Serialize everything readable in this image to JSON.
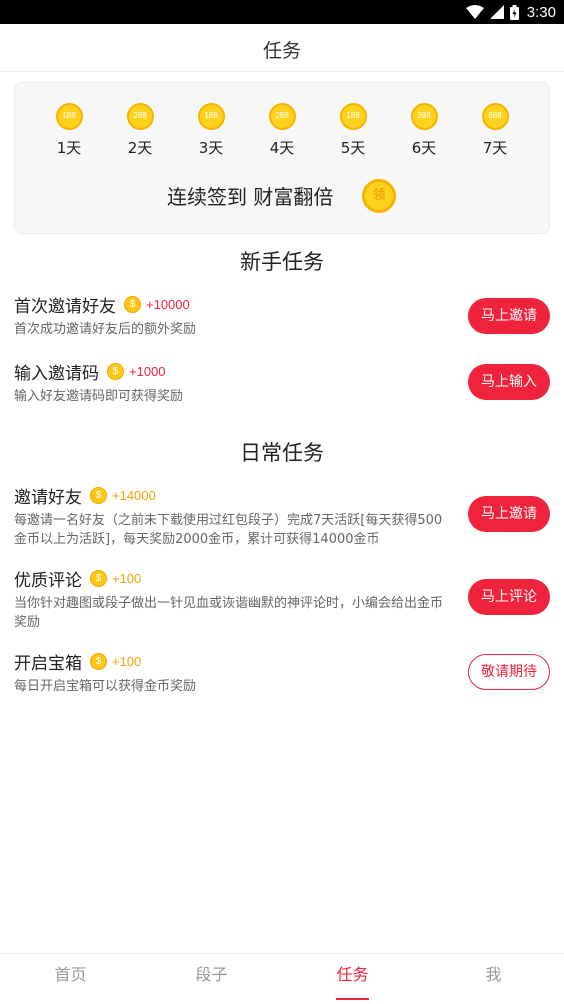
{
  "status_bar": {
    "time": "3:30"
  },
  "header": {
    "title": "任务"
  },
  "checkin": {
    "days": [
      {
        "coin": "188",
        "label": "1天"
      },
      {
        "coin": "288",
        "label": "2天"
      },
      {
        "coin": "188",
        "label": "3天"
      },
      {
        "coin": "288",
        "label": "4天"
      },
      {
        "coin": "188",
        "label": "5天"
      },
      {
        "coin": "288",
        "label": "6天"
      },
      {
        "coin": "688",
        "label": "7天"
      }
    ],
    "slogan": "连续签到 财富翻倍",
    "claim_label": "领"
  },
  "coin_glyph": "$",
  "newbie": {
    "title": "新手任务",
    "tasks": [
      {
        "name": "首次邀请好友",
        "reward": "+10000",
        "desc": "首次成功邀请好友后的额外奖励",
        "button": "马上邀请"
      },
      {
        "name": "输入邀请码",
        "reward": "+1000",
        "desc": "输入好友邀请码即可获得奖励",
        "button": "马上输入"
      }
    ]
  },
  "daily": {
    "title": "日常任务",
    "tasks": [
      {
        "name": "邀请好友",
        "reward": "+14000",
        "desc": "每邀请一名好友（之前未下载使用过红包段子）完成7天活跃[每天获得500金币以上为活跃]，每天奖励2000金币，累计可获得14000金币",
        "button": "马上邀请"
      },
      {
        "name": "优质评论",
        "reward": "+100",
        "desc": "当你针对趣图或段子做出一针见血或诙谐幽默的神评论时，小编会给出金币奖励",
        "button": "马上评论"
      },
      {
        "name": "开启宝箱",
        "reward": "+100",
        "desc": "每日开启宝箱可以获得金币奖励",
        "button": "敬请期待"
      }
    ]
  },
  "tabs": [
    {
      "label": "首页"
    },
    {
      "label": "段子"
    },
    {
      "label": "任务"
    },
    {
      "label": "我"
    }
  ],
  "colors": {
    "accent": "#f0233c",
    "coin": "#ffd21f",
    "reward_orange": "#f4a000"
  }
}
